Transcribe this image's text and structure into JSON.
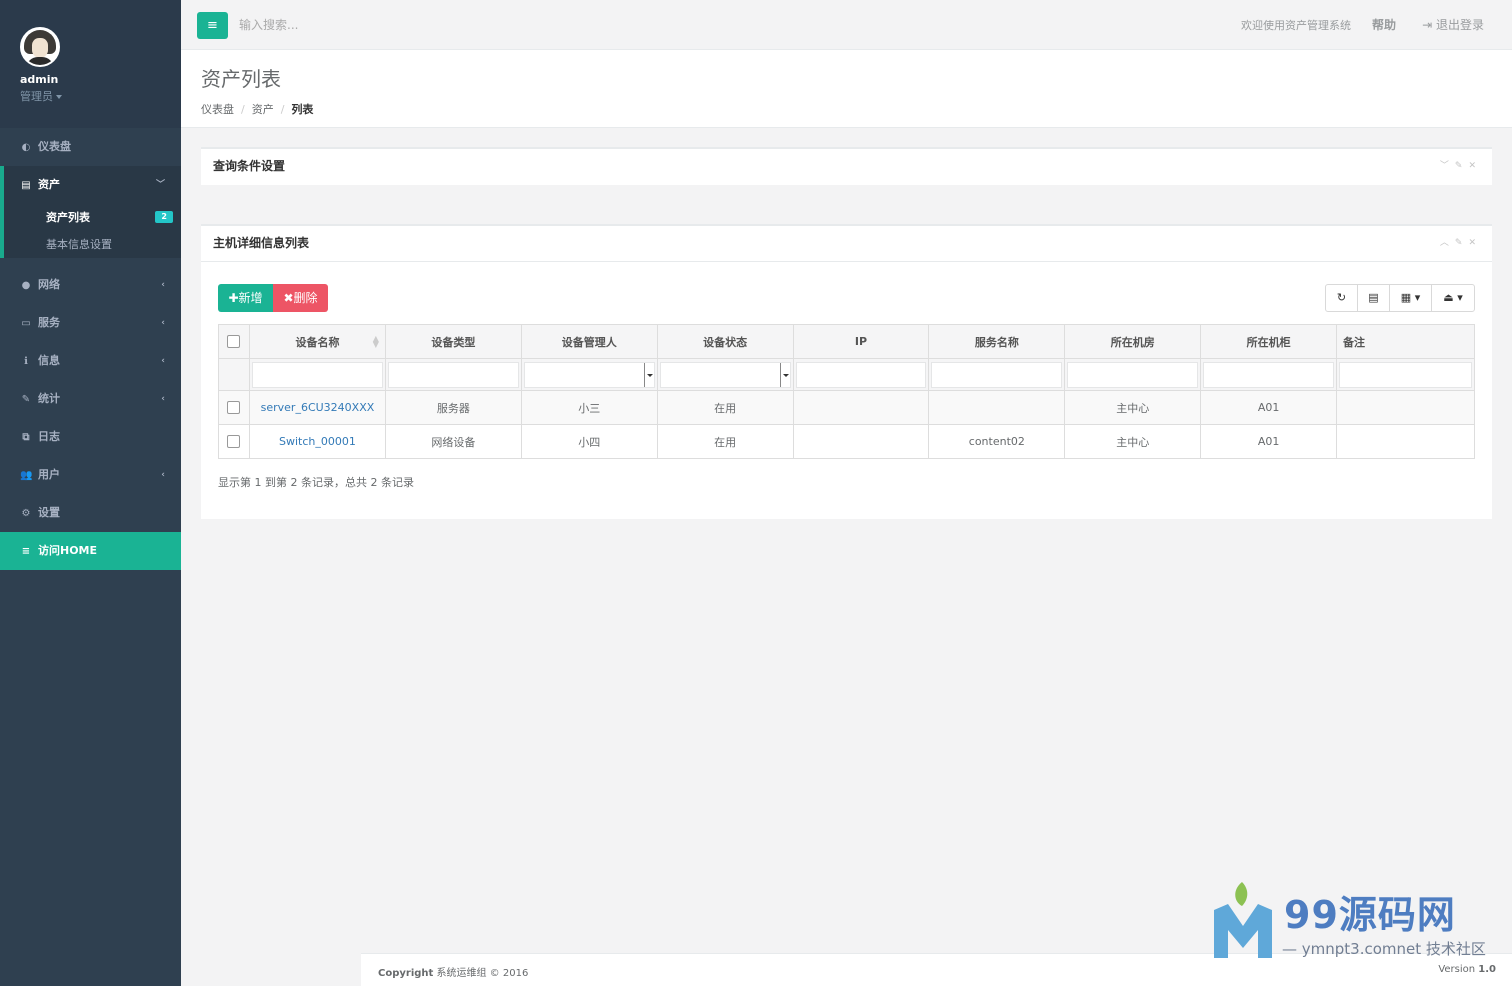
{
  "sidebar": {
    "profile": {
      "username": "admin",
      "role": "管理员"
    },
    "items": [
      {
        "icon": "dashboard-icon",
        "glyph": "◐",
        "label": "仪表盘"
      },
      {
        "icon": "table-icon",
        "glyph": "▤",
        "label": "资产"
      },
      {
        "icon": "globe-icon",
        "glyph": "●",
        "label": "网络"
      },
      {
        "icon": "hdd-icon",
        "glyph": "▭",
        "label": "服务"
      },
      {
        "icon": "info-icon",
        "glyph": "ℹ",
        "label": "信息"
      },
      {
        "icon": "edit-icon",
        "glyph": "✎",
        "label": "统计"
      },
      {
        "icon": "copy-icon",
        "glyph": "⧉",
        "label": "日志"
      },
      {
        "icon": "users-icon",
        "glyph": "👥",
        "label": "用户"
      },
      {
        "icon": "cogs-icon",
        "glyph": "⚙",
        "label": "设置"
      },
      {
        "icon": "database-icon",
        "glyph": "≡",
        "label": "访问HOME"
      }
    ],
    "subitems": [
      {
        "label": "资产列表",
        "badge": "2"
      },
      {
        "label": "基本信息设置"
      }
    ]
  },
  "topbar": {
    "search_placeholder": "输入搜索...",
    "welcome": "欢迎使用资产管理系统",
    "help": "帮助",
    "logout": "退出登录"
  },
  "heading": {
    "title": "资产列表",
    "breadcrumb": [
      "仪表盘",
      "资产",
      "列表"
    ]
  },
  "query_panel": {
    "title": "查询条件设置"
  },
  "list_panel": {
    "title": "主机详细信息列表",
    "add_label": "新增",
    "delete_label": "删除",
    "columns": [
      "设备名称",
      "设备类型",
      "设备管理人",
      "设备状态",
      "IP",
      "服务名称",
      "所在机房",
      "所在机柜",
      "备注"
    ],
    "rows": [
      [
        "server_6CU3240XXX",
        "服务器",
        "小三",
        "在用",
        "",
        "",
        "主中心",
        "A01",
        ""
      ],
      [
        "Switch_00001",
        "网络设备",
        "小四",
        "在用",
        "",
        "content02",
        "主中心",
        "A01",
        ""
      ]
    ],
    "pager": "显示第 1 到第 2 条记录，总共 2 条记录"
  },
  "footer": {
    "copyright_label": "Copyright",
    "copyright_text": "系统运维组 © 2016",
    "version_label": "Version",
    "version_value": "1.0"
  },
  "watermark": {
    "brand": "99源码网",
    "sub": "— ymnpt3.comnet 技术社区"
  },
  "colors": {
    "sidebar_bg": "#2f4050",
    "accent_green": "#1ab394",
    "danger_red": "#ed5565",
    "badge_teal": "#23c6c8",
    "link_blue": "#337ab7"
  }
}
